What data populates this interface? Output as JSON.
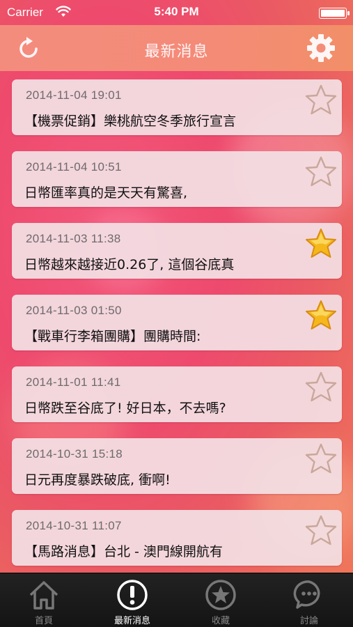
{
  "status_bar": {
    "carrier": "Carrier",
    "time": "5:40 PM",
    "battery_percent": 100
  },
  "nav": {
    "title": "最新消息"
  },
  "feed": [
    {
      "date": "2014-11-04 19:01",
      "title": "【機票促銷】樂桃航空冬季旅行宣言",
      "starred": false
    },
    {
      "date": "2014-11-04 10:51",
      "title": "日幣匯率真的是天天有驚喜,",
      "starred": false
    },
    {
      "date": "2014-11-03 11:38",
      "title": "日幣越來越接近0.26了, 這個谷底真",
      "starred": true
    },
    {
      "date": "2014-11-03 01:50",
      "title": "【戰車行李箱團購】團購時間:",
      "starred": true
    },
    {
      "date": "2014-11-01 11:41",
      "title": "日幣跌至谷底了! 好日本，不去嗎?",
      "starred": false
    },
    {
      "date": "2014-10-31 15:18",
      "title": "日元再度暴跌破底, 衝啊!",
      "starred": false
    },
    {
      "date": "2014-10-31 11:07",
      "title": "【馬路消息】台北 - 澳門線開航有",
      "starred": false
    }
  ],
  "tabs": [
    {
      "label": "首頁",
      "icon": "home-icon",
      "active": false
    },
    {
      "label": "最新消息",
      "icon": "exclamation-icon",
      "active": true
    },
    {
      "label": "收藏",
      "icon": "star-icon",
      "active": false
    },
    {
      "label": "討論",
      "icon": "chat-icon",
      "active": false
    }
  ],
  "colors": {
    "star_filled": "#f5b81c",
    "star_outline": "#c9a79a",
    "tab_active": "#ffffff",
    "tab_inactive": "#888888"
  }
}
